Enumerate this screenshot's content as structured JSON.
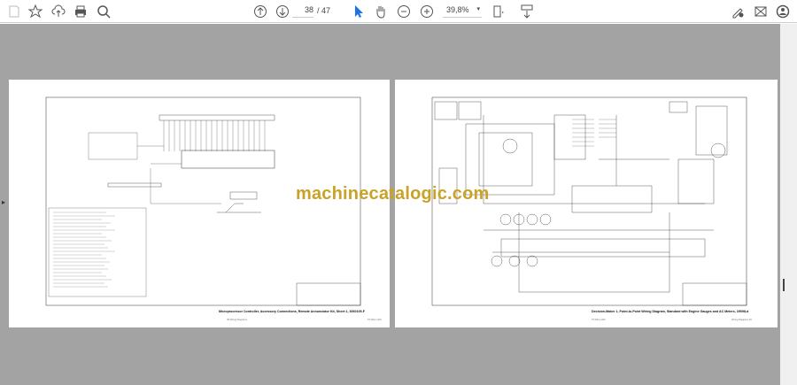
{
  "toolbar": {
    "icons": [
      "save-icon",
      "bookmark-star-icon",
      "upload-cloud-icon",
      "print-icon",
      "search-zoom-icon",
      "page-up-icon",
      "page-down-icon",
      "select-cursor-icon",
      "hand-tool-icon",
      "zoom-out-icon",
      "zoom-in-icon",
      "fit-page-icon",
      "scroll-mode-icon",
      "sign-icon",
      "mail-icon",
      "account-icon"
    ],
    "current_page": "38",
    "total_pages": "/ 47",
    "zoom_level": "39,8%",
    "accent": "#1a73e8"
  },
  "pages": [
    {
      "caption": "Microprocessor Controller, Accessory Connections, Remote Annunciator Kit, Sheet 1, 3060105-F",
      "footer_left": "38     Wiring Diagrams",
      "footer_right": "TP-6011 1/06"
    },
    {
      "caption": "Decision-Maker 1, Point-to-Point Wiring Diagram, Standard with Engine Gauges and AC Meters, 3/f098-d",
      "footer_left": "TP-6011 1/06",
      "footer_right": "Wiring Diagrams     39"
    }
  ],
  "watermark": "machinecatalogic.com",
  "watermark_color": "#c9a227"
}
